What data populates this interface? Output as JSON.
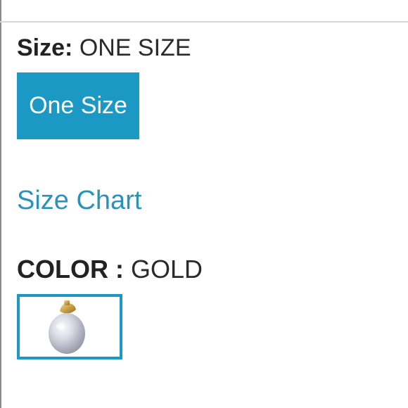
{
  "size_section": {
    "label": "Size:",
    "selected_value": "ONE SIZE",
    "options": [
      {
        "label": "One Size",
        "selected": true
      }
    ],
    "size_chart_link": "Size Chart"
  },
  "color_section": {
    "label": "COLOR :",
    "selected_value": "GOLD",
    "swatches": [
      {
        "icon": "pearl-pendant-icon",
        "selected": true
      }
    ]
  },
  "colors": {
    "accent": "#1b98c4",
    "link": "#2a93b9",
    "text": "#222222"
  }
}
